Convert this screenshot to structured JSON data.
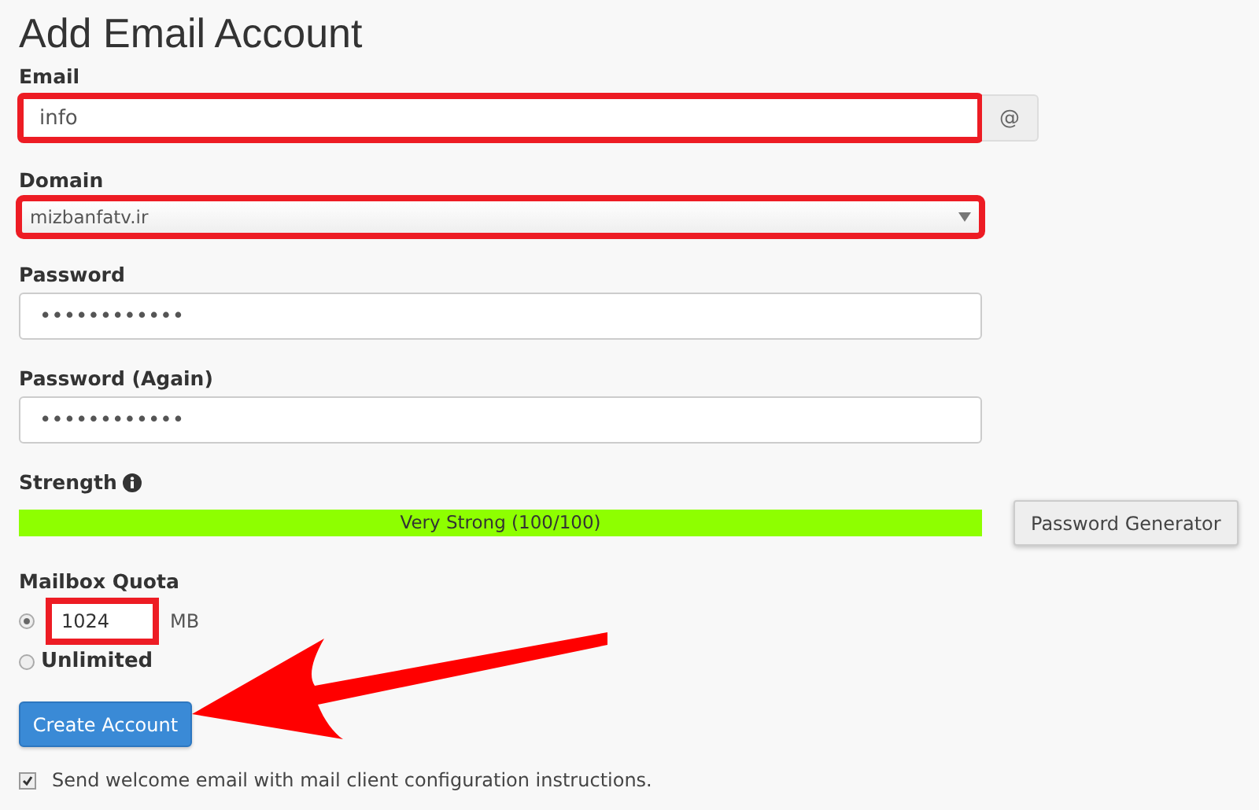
{
  "title": "Add Email Account",
  "email": {
    "label": "Email",
    "value": "info",
    "addon": "@",
    "highlighted": true
  },
  "domain": {
    "label": "Domain",
    "value": "mizbanfatv.ir",
    "highlighted": true
  },
  "password": {
    "label": "Password",
    "value": "••••••••••••"
  },
  "password_again": {
    "label": "Password (Again)",
    "value": "••••••••••••"
  },
  "strength": {
    "label": "Strength",
    "reading": "Very Strong (100/100)",
    "level": 1
  },
  "password_generator": "Password Generator",
  "quota": {
    "label": "Mailbox Quota",
    "options": [
      {
        "kind": "amount",
        "selected": true,
        "value": "1024",
        "unit": "MB",
        "highlighted": true
      },
      {
        "kind": "unlimited",
        "selected": false,
        "label": "Unlimited"
      }
    ]
  },
  "create_button": "Create Account",
  "welcome": {
    "label": "Send welcome email with mail client configuration instructions.",
    "checked": true
  }
}
